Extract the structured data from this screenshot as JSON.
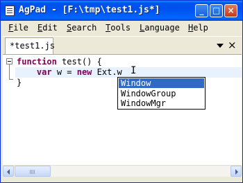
{
  "window": {
    "title": "AgPad - [F:\\tmp\\test1.js*]",
    "title_icon": "notepad-icon",
    "buttons": {
      "minimize": "_",
      "maximize": "□",
      "close": "×"
    }
  },
  "menu": [
    "File",
    "Edit",
    "Search",
    "Tools",
    "Language",
    "Help"
  ],
  "tab": {
    "label": "*test1.js",
    "menu_icon": "chevron-down-icon",
    "close_icon": "close-icon",
    "close_glyph": "×"
  },
  "editor": {
    "lines": [
      {
        "kw": "function",
        "rest": " test() {"
      },
      {
        "indent": "    ",
        "kw1": "var",
        "mid": " w = ",
        "kw2": "new",
        "rest": " Ext.w"
      },
      {
        "text": "}"
      }
    ],
    "autocomplete": {
      "items": [
        "Window",
        "WindowGroup",
        "WindowMgr"
      ],
      "selected_index": 0
    }
  },
  "colors": {
    "title_bar": "#0053ee",
    "selection": "#316ac5",
    "keyword": "#7f0055",
    "current_line": "#e8f2fe"
  }
}
